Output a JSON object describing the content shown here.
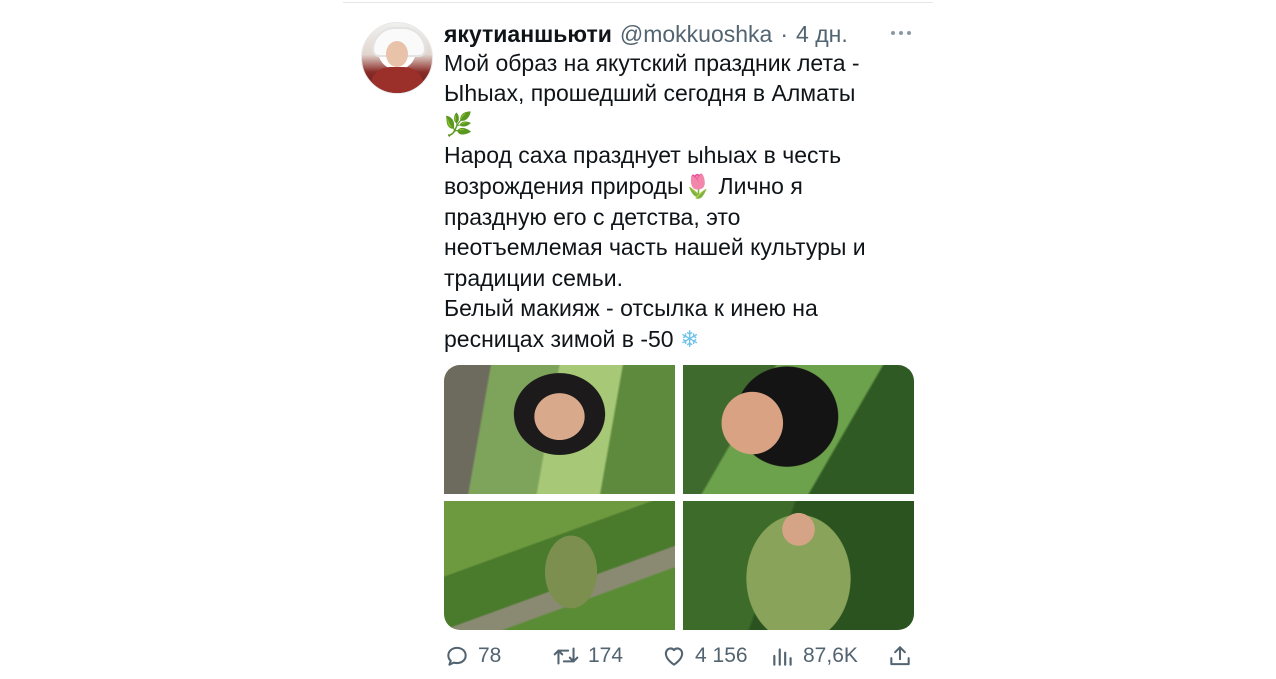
{
  "tweet": {
    "author_name": "якутианшьюти",
    "author_handle": "@mokkuoshka",
    "separator": "·",
    "time": "4 дн.",
    "text_lines": [
      {
        "text": "Мой образ на якутский праздник лета -"
      },
      {
        "text": "Ыhыах, прошедший сегодня в Алматы"
      },
      {
        "emoji": "🌿"
      },
      {
        "text": "Народ саха празднует ыhыах в честь"
      },
      {
        "text_a": "возрождения природы",
        "emoji": "🌷",
        "text_b": " Лично я"
      },
      {
        "text": "праздную его с детства, это"
      },
      {
        "text": "неотъемлемая часть нашей культуры и"
      },
      {
        "text": "традиции семьи."
      },
      {
        "text": "Белый макияж - отсылка к инею на"
      },
      {
        "text": "ресницах зимой в -50 ",
        "emoji": "❄"
      }
    ],
    "media_count": 4,
    "stats": {
      "replies": "78",
      "retweets": "174",
      "likes": "4 156",
      "views": "87,6K"
    }
  },
  "icons": {
    "more": "more-horizontal-icon",
    "reply": "speech-bubble-icon",
    "retweet": "retweet-arrows-icon",
    "like": "heart-icon",
    "views": "bar-chart-icon",
    "share": "share-upload-icon"
  },
  "colors": {
    "text": "#0f1419",
    "secondary": "#536471",
    "divider": "#e6e6e6"
  }
}
